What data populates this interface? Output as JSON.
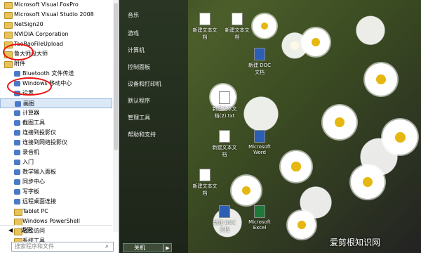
{
  "start_menu": {
    "programs": [
      {
        "label": "Microsoft Visual FoxPro",
        "type": "folder"
      },
      {
        "label": "Microsoft Visual Studio 2008",
        "type": "folder"
      },
      {
        "label": "NetSign20",
        "type": "folder"
      },
      {
        "label": "NVIDIA Corporation",
        "type": "folder"
      },
      {
        "label": "TaoBaoFileUpload",
        "type": "folder"
      },
      {
        "label": "鲁大师设大师",
        "type": "folder"
      },
      {
        "label": "附件",
        "type": "folder"
      },
      {
        "label": "Bluetooth 文件传送",
        "type": "app"
      },
      {
        "label": "Windows 移动中心",
        "type": "app"
      },
      {
        "label": "设置",
        "type": "app"
      },
      {
        "label": "画图",
        "type": "app",
        "highlight": true
      },
      {
        "label": "计算器",
        "type": "app"
      },
      {
        "label": "截图工具",
        "type": "app"
      },
      {
        "label": "连接到投影仪",
        "type": "app"
      },
      {
        "label": "连接到网络投影仪",
        "type": "app"
      },
      {
        "label": "录音机",
        "type": "app"
      },
      {
        "label": "入门",
        "type": "app"
      },
      {
        "label": "数学输入面板",
        "type": "app"
      },
      {
        "label": "同步中心",
        "type": "app"
      },
      {
        "label": "写字板",
        "type": "app"
      },
      {
        "label": "远程桌面连接",
        "type": "app"
      },
      {
        "label": "Tablet PC",
        "type": "folder"
      },
      {
        "label": "Windows PowerShell",
        "type": "folder"
      },
      {
        "label": "轻松访问",
        "type": "folder"
      },
      {
        "label": "系统工具",
        "type": "folder"
      }
    ],
    "back_label": "返回",
    "search_placeholder": "搜索程序和文件",
    "right_items": [
      "音乐",
      "游戏",
      "计算机",
      "控制面板",
      "设备和打印机",
      "默认程序",
      "管理工具",
      "帮助和支持"
    ],
    "shutdown_label": "关机"
  },
  "desktop_icons": [
    {
      "label": "新建文本文档",
      "kind": "doc"
    },
    {
      "label": "新建文本文档",
      "kind": "doc"
    },
    {
      "label": "新建 DOC 文档",
      "kind": "word"
    },
    {
      "label": "新建文本文档(2).txt",
      "kind": "doc"
    },
    {
      "label": "新建文本文档",
      "kind": "doc"
    },
    {
      "label": "Microsoft Word",
      "kind": "word"
    },
    {
      "label": "新建文本文档",
      "kind": "doc"
    },
    {
      "label": "新建 DOC 文档",
      "kind": "word"
    },
    {
      "label": "Microsoft Excel",
      "kind": "excel"
    }
  ],
  "watermark": "爱剪根知识网"
}
